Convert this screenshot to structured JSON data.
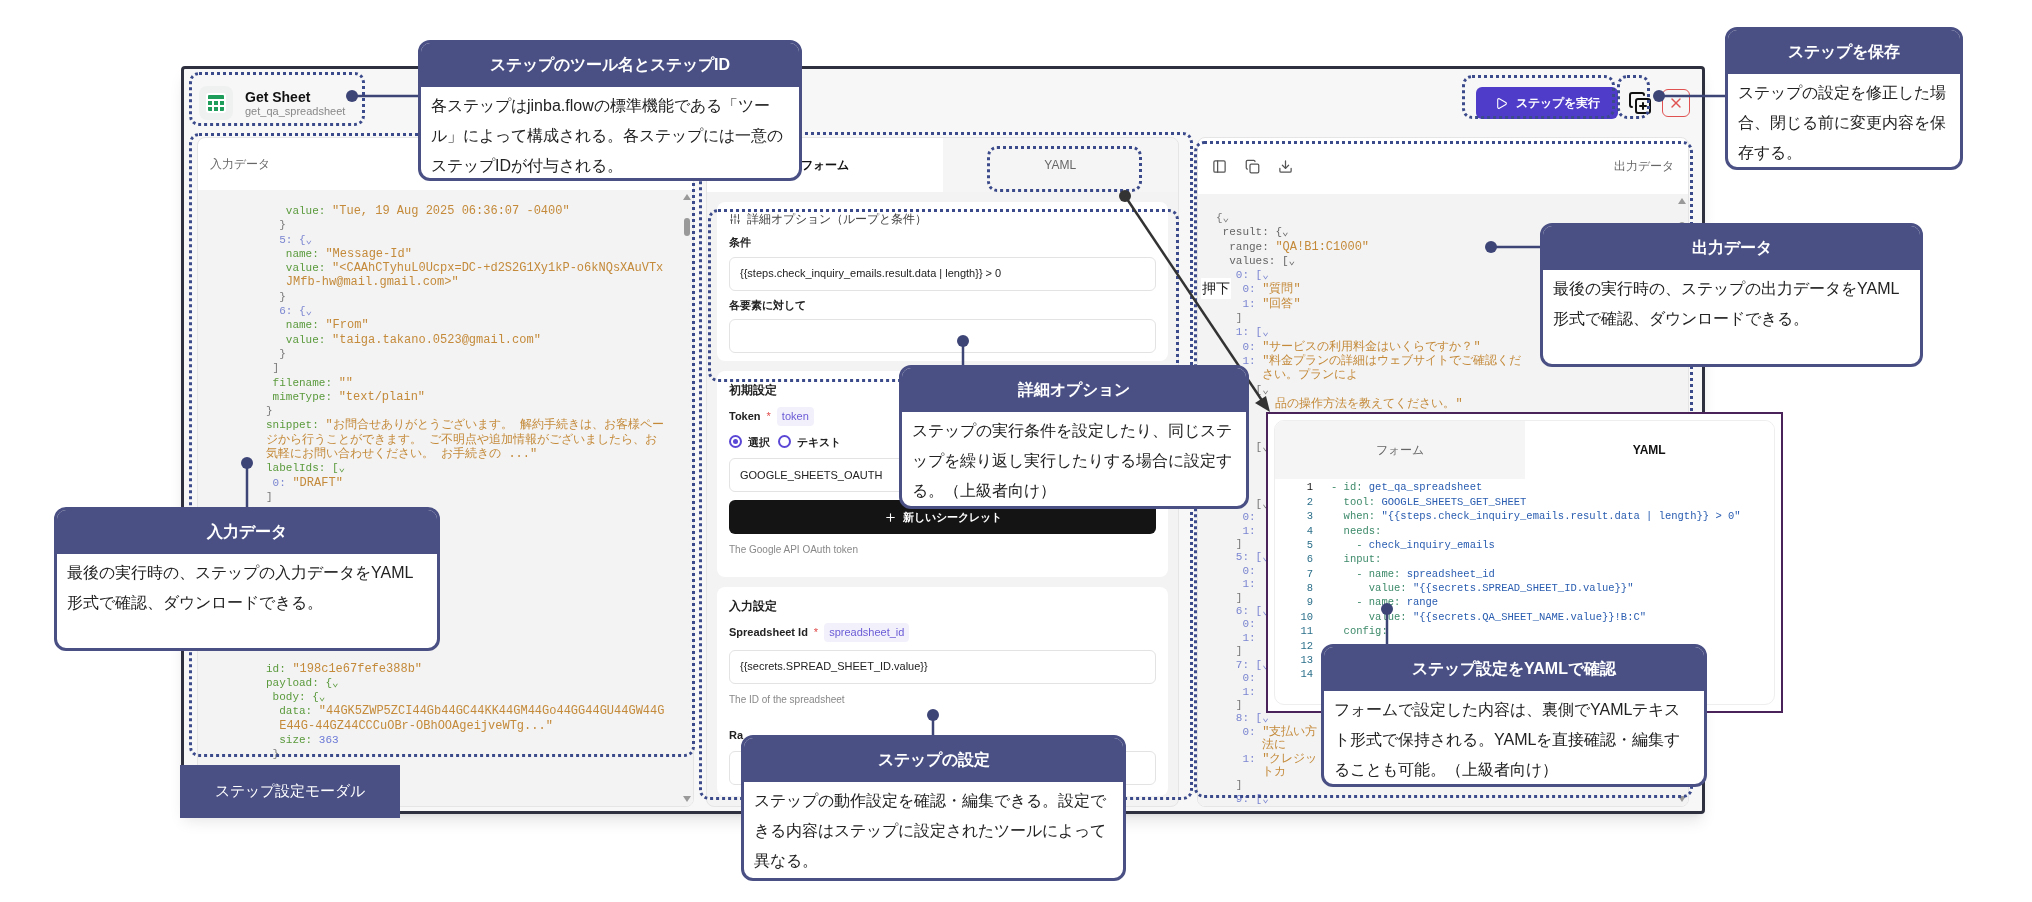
{
  "header": {
    "title": "Get Sheet",
    "step_id": "get_qa_spreadsheet",
    "run_button": "ステップを実行"
  },
  "input_panel": {
    "title": "入力データ",
    "lines": [
      {
        "kind": "code",
        "parts": [
          {
            "text": "   value: ",
            "kind": "name"
          },
          {
            "text": "\"Tue, 19 Aug 2025 06:36:07 -0400\"",
            "kind": "string"
          }
        ]
      },
      {
        "kind": "code",
        "parts": [
          {
            "text": "  }",
            "kind": "bracket"
          }
        ]
      },
      {
        "kind": "code",
        "parts": [
          {
            "text": "  5: {⌄",
            "kind": "index"
          }
        ]
      },
      {
        "kind": "code",
        "parts": [
          {
            "text": "   name: ",
            "kind": "name"
          },
          {
            "text": "\"Message-Id\"",
            "kind": "string"
          }
        ]
      },
      {
        "kind": "code",
        "parts": [
          {
            "text": "   value: ",
            "kind": "name"
          },
          {
            "text": "\"<CAAhCTyhuL0Ucpx=DC-+d2S2G1Xy1kP-o6kNQsXAuVTxJMfb-hw@mail.gmail.com>\"",
            "kind": "string"
          }
        ]
      },
      {
        "kind": "code",
        "parts": [
          {
            "text": "  }",
            "kind": "bracket"
          }
        ]
      },
      {
        "kind": "code",
        "parts": [
          {
            "text": "  6: {⌄",
            "kind": "index"
          }
        ]
      },
      {
        "kind": "code",
        "parts": [
          {
            "text": "   name: ",
            "kind": "name"
          },
          {
            "text": "\"From\"",
            "kind": "string"
          }
        ]
      },
      {
        "kind": "code",
        "parts": [
          {
            "text": "   value: ",
            "kind": "name"
          },
          {
            "text": "\"taiga.takano.0523@gmail.com\"",
            "kind": "string"
          }
        ]
      },
      {
        "kind": "code",
        "parts": [
          {
            "text": "  }",
            "kind": "bracket"
          }
        ]
      },
      {
        "kind": "code",
        "parts": [
          {
            "text": " ]",
            "kind": "bracket"
          }
        ]
      },
      {
        "kind": "code",
        "parts": [
          {
            "text": " filename: ",
            "kind": "name"
          },
          {
            "text": "\"\"",
            "kind": "string"
          }
        ]
      },
      {
        "kind": "code",
        "parts": [
          {
            "text": " mimeType: ",
            "kind": "name"
          },
          {
            "text": "\"text/plain\"",
            "kind": "string"
          }
        ]
      },
      {
        "kind": "code",
        "parts": [
          {
            "text": "}",
            "kind": "bracket"
          }
        ]
      },
      {
        "kind": "code",
        "parts": [
          {
            "text": "snippet: ",
            "kind": "name"
          },
          {
            "text": "\"お問合せありがとうございます。 解約手続きは、お客様ページから行うことができます。 ご不明点や追加情報がございましたら、お気軽にお問い合わせください。 お手続きの ...\"",
            "kind": "string"
          }
        ]
      },
      {
        "kind": "code",
        "parts": [
          {
            "text": "labelIds: [⌄",
            "kind": "name"
          }
        ]
      },
      {
        "kind": "code",
        "parts": [
          {
            "text": " 0: ",
            "kind": "index"
          },
          {
            "text": "\"DRAFT\"",
            "kind": "string"
          }
        ]
      },
      {
        "kind": "code",
        "parts": [
          {
            "text": "]",
            "kind": "bracket"
          }
        ]
      },
      {
        "kind": "blank"
      },
      {
        "kind": "blank"
      },
      {
        "kind": "blank"
      },
      {
        "kind": "blank"
      },
      {
        "kind": "blank"
      },
      {
        "kind": "blank"
      },
      {
        "kind": "blank"
      },
      {
        "kind": "blank"
      },
      {
        "kind": "blank"
      },
      {
        "kind": "blank"
      },
      {
        "kind": "blank"
      },
      {
        "kind": "code",
        "parts": [
          {
            "text": "id: ",
            "kind": "name"
          },
          {
            "text": "\"198c1e67fefe388b\"",
            "kind": "string"
          }
        ]
      },
      {
        "kind": "code",
        "parts": [
          {
            "text": "payload: {⌄",
            "kind": "name"
          }
        ]
      },
      {
        "kind": "code",
        "parts": [
          {
            "text": " body: {⌄",
            "kind": "name"
          }
        ]
      },
      {
        "kind": "code",
        "parts": [
          {
            "text": "  data: ",
            "kind": "name"
          },
          {
            "text": "\"44GK5ZWP5ZCI44Gb44GC44KK44GM44Go44GG44GU44GW44GE44G-44GZ44CCCuOBr-OBhOOAgeijveWTg...\"",
            "kind": "string"
          }
        ]
      },
      {
        "kind": "code",
        "parts": [
          {
            "text": "  size: ",
            "kind": "name"
          },
          {
            "text": "363",
            "kind": "number"
          }
        ]
      },
      {
        "kind": "code",
        "parts": [
          {
            "text": " }",
            "kind": "bracket"
          }
        ]
      }
    ]
  },
  "form_panel": {
    "tabs": [
      {
        "label": "フォーム",
        "selected": true
      },
      {
        "label": "YAML",
        "selected": false
      }
    ],
    "advanced": {
      "title": "詳細オプション（ループと条件）",
      "condition_label": "条件",
      "condition_value": "{{steps.check_inquiry_emails.result.data | length}} > 0",
      "for_each_label": "各要素に対して"
    },
    "initial": {
      "title": "初期設定",
      "label": "Token",
      "required_mark": "*",
      "key": "token",
      "radios": [
        {
          "label": "選択",
          "selected": true
        },
        {
          "label": "テキスト",
          "selected": false
        }
      ],
      "select_value": "GOOGLE_SHEETS_OAUTH",
      "new_secret_button": "新しいシークレット",
      "hint": "The Google API OAuth token"
    },
    "inputs": {
      "title": "入力設定",
      "label": "Spreadsheet Id",
      "required_mark": "*",
      "key": "spreadsheet_id",
      "value": "{{secrets.SPREAD_SHEET_ID.value}}",
      "hint": "The ID of the spreadsheet",
      "next_label": "Ra"
    }
  },
  "output_panel": {
    "title": "出力データ",
    "lines": [
      {
        "kind": "code",
        "parts": [
          {
            "text": "{⌄",
            "kind": "bracket"
          }
        ]
      },
      {
        "kind": "code",
        "parts": [
          {
            "text": " result: {⌄",
            "kind": "field"
          }
        ]
      },
      {
        "kind": "code",
        "parts": [
          {
            "text": "  range: ",
            "kind": "field"
          },
          {
            "text": "\"QA!B1:C1000\"",
            "kind": "string"
          }
        ]
      },
      {
        "kind": "code",
        "parts": [
          {
            "text": "  values: [⌄",
            "kind": "field"
          }
        ]
      },
      {
        "kind": "code",
        "parts": [
          {
            "text": "   0: [⌄",
            "kind": "index"
          }
        ]
      },
      {
        "kind": "code",
        "parts": [
          {
            "text": "    0: ",
            "kind": "index"
          },
          {
            "text": "\"質問\"",
            "kind": "string"
          }
        ]
      },
      {
        "kind": "code",
        "parts": [
          {
            "text": "    1: ",
            "kind": "index"
          },
          {
            "text": "\"回答\"",
            "kind": "string"
          }
        ]
      },
      {
        "kind": "code",
        "parts": [
          {
            "text": "   ]",
            "kind": "bracket"
          }
        ]
      },
      {
        "kind": "code",
        "parts": [
          {
            "text": "   1: [⌄",
            "kind": "index"
          }
        ]
      },
      {
        "kind": "code",
        "parts": [
          {
            "text": "    0: ",
            "kind": "index"
          },
          {
            "text": "\"サービスの利用料金はいくらですか？\"",
            "kind": "string"
          }
        ]
      },
      {
        "kind": "code",
        "parts": [
          {
            "text": "    1: ",
            "kind": "index"
          },
          {
            "text": "\"料金プランの詳細はウェブサイトでご確認ください。プランによ",
            "kind": "string"
          }
        ]
      },
      {
        "kind": "code",
        "parts": [
          {
            "text": "      [⌄",
            "kind": "bracket"
          }
        ]
      },
      {
        "kind": "code",
        "parts": [
          {
            "text": "         品の操作方法を教えてください。\"",
            "kind": "string"
          }
        ]
      },
      {
        "kind": "blank"
      },
      {
        "kind": "blank"
      },
      {
        "kind": "code",
        "parts": [
          {
            "text": "      [⌄",
            "kind": "bracket"
          }
        ]
      },
      {
        "kind": "blank"
      },
      {
        "kind": "blank"
      },
      {
        "kind": "blank"
      },
      {
        "kind": "code",
        "parts": [
          {
            "text": "      [⌄",
            "kind": "bracket"
          }
        ]
      },
      {
        "kind": "code",
        "parts": [
          {
            "text": "    0:",
            "kind": "index"
          }
        ]
      },
      {
        "kind": "code",
        "parts": [
          {
            "text": "    1:",
            "kind": "index"
          }
        ]
      },
      {
        "kind": "code",
        "parts": [
          {
            "text": "   ]",
            "kind": "bracket"
          }
        ]
      },
      {
        "kind": "code",
        "parts": [
          {
            "text": "   5: [⌄",
            "kind": "index"
          }
        ]
      },
      {
        "kind": "code",
        "parts": [
          {
            "text": "    0:",
            "kind": "index"
          }
        ]
      },
      {
        "kind": "code",
        "parts": [
          {
            "text": "    1:",
            "kind": "index"
          }
        ]
      },
      {
        "kind": "code",
        "parts": [
          {
            "text": "   ]",
            "kind": "bracket"
          }
        ]
      },
      {
        "kind": "code",
        "parts": [
          {
            "text": "   6: [⌄",
            "kind": "index"
          }
        ]
      },
      {
        "kind": "code",
        "parts": [
          {
            "text": "    0:",
            "kind": "index"
          }
        ]
      },
      {
        "kind": "code",
        "parts": [
          {
            "text": "    1:",
            "kind": "index"
          }
        ]
      },
      {
        "kind": "code",
        "parts": [
          {
            "text": "   ]",
            "kind": "bracket"
          }
        ]
      },
      {
        "kind": "code",
        "parts": [
          {
            "text": "   7: [⌄",
            "kind": "index"
          }
        ]
      },
      {
        "kind": "code",
        "parts": [
          {
            "text": "    0:",
            "kind": "index"
          }
        ]
      },
      {
        "kind": "code",
        "parts": [
          {
            "text": "    1:",
            "kind": "index"
          }
        ]
      },
      {
        "kind": "code",
        "parts": [
          {
            "text": "   ]",
            "kind": "bracket"
          }
        ]
      },
      {
        "kind": "code",
        "parts": [
          {
            "text": "   8: [⌄",
            "kind": "index"
          }
        ]
      },
      {
        "kind": "code",
        "parts": [
          {
            "text": "    0: ",
            "kind": "index"
          },
          {
            "text": "\"支払い方法に",
            "kind": "string"
          }
        ]
      },
      {
        "kind": "code",
        "parts": [
          {
            "text": "    1: ",
            "kind": "index"
          },
          {
            "text": "\"クレジットカ",
            "kind": "string"
          }
        ]
      },
      {
        "kind": "code",
        "parts": [
          {
            "text": "   ]",
            "kind": "bracket"
          }
        ]
      },
      {
        "kind": "code",
        "parts": [
          {
            "text": "   9: [⌄",
            "kind": "index"
          }
        ]
      }
    ]
  },
  "yaml_preview": {
    "tabs": [
      {
        "label": "フォーム",
        "selected": false
      },
      {
        "label": "YAML",
        "selected": true
      }
    ],
    "lines": [
      {
        "number": "1",
        "key": "- id: ",
        "value": "get_qa_spreadsheet"
      },
      {
        "number": "2",
        "key": "  tool: ",
        "value": "GOOGLE_SHEETS_GET_SHEET"
      },
      {
        "number": "3",
        "key": "  when: ",
        "value": "\"{{steps.check_inquiry_emails.result.data | length}} > 0\""
      },
      {
        "number": "4",
        "key": "  needs:"
      },
      {
        "number": "5",
        "key": "    - ",
        "value": "check_inquiry_emails"
      },
      {
        "number": "6",
        "key": "  input:"
      },
      {
        "number": "7",
        "key": "    - name: ",
        "value": "spreadsheet_id"
      },
      {
        "number": "8",
        "key": "      value: ",
        "value": "\"{{secrets.SPREAD_SHEET_ID.value}}\""
      },
      {
        "number": "9",
        "key": "    - name: ",
        "value": "range"
      },
      {
        "number": "10",
        "key": "      value: ",
        "value": "\"{{secrets.QA_SHEET_NAME.value}}!B:C\""
      },
      {
        "number": "11",
        "key": "  config:"
      },
      {
        "number": "12"
      },
      {
        "number": "13"
      },
      {
        "number": "14"
      }
    ]
  },
  "press_label": "押下",
  "modal_label": "ステップ設定モーダル",
  "callouts": [
    {
      "title": "ステップのツール名とステップID",
      "body": "各ステップはjinba.flowの標準機能である「ツール」によって構成される。各ステップには一意のステップIDが付与される。"
    },
    {
      "title": "ステップを保存",
      "body": "ステップの設定を修正した場合、閉じる前に変更内容を保存する。"
    },
    {
      "title": "出力データ",
      "body": "最後の実行時の、ステップの出力データをYAML形式で確認、ダウンロードできる。"
    },
    {
      "title": "詳細オプション",
      "body": "ステップの実行条件を設定したり、同じステップを繰り返し実行したりする場合に設定する。（上級者向け）"
    },
    {
      "title": "入力データ",
      "body": "最後の実行時の、ステップの入力データをYAML形式で確認、ダウンロードできる。"
    },
    {
      "title": "ステップ設定をYAMLで確認",
      "body": "フォームで設定した内容は、裏側でYAMLテキスト形式で保持される。YAMLを直接確認・編集することも可能。（上級者向け）"
    },
    {
      "title": "ステップの設定",
      "body": "ステップの動作設定を確認・編集できる。設定できる内容はステップに設定されたツールによって異なる。"
    }
  ]
}
